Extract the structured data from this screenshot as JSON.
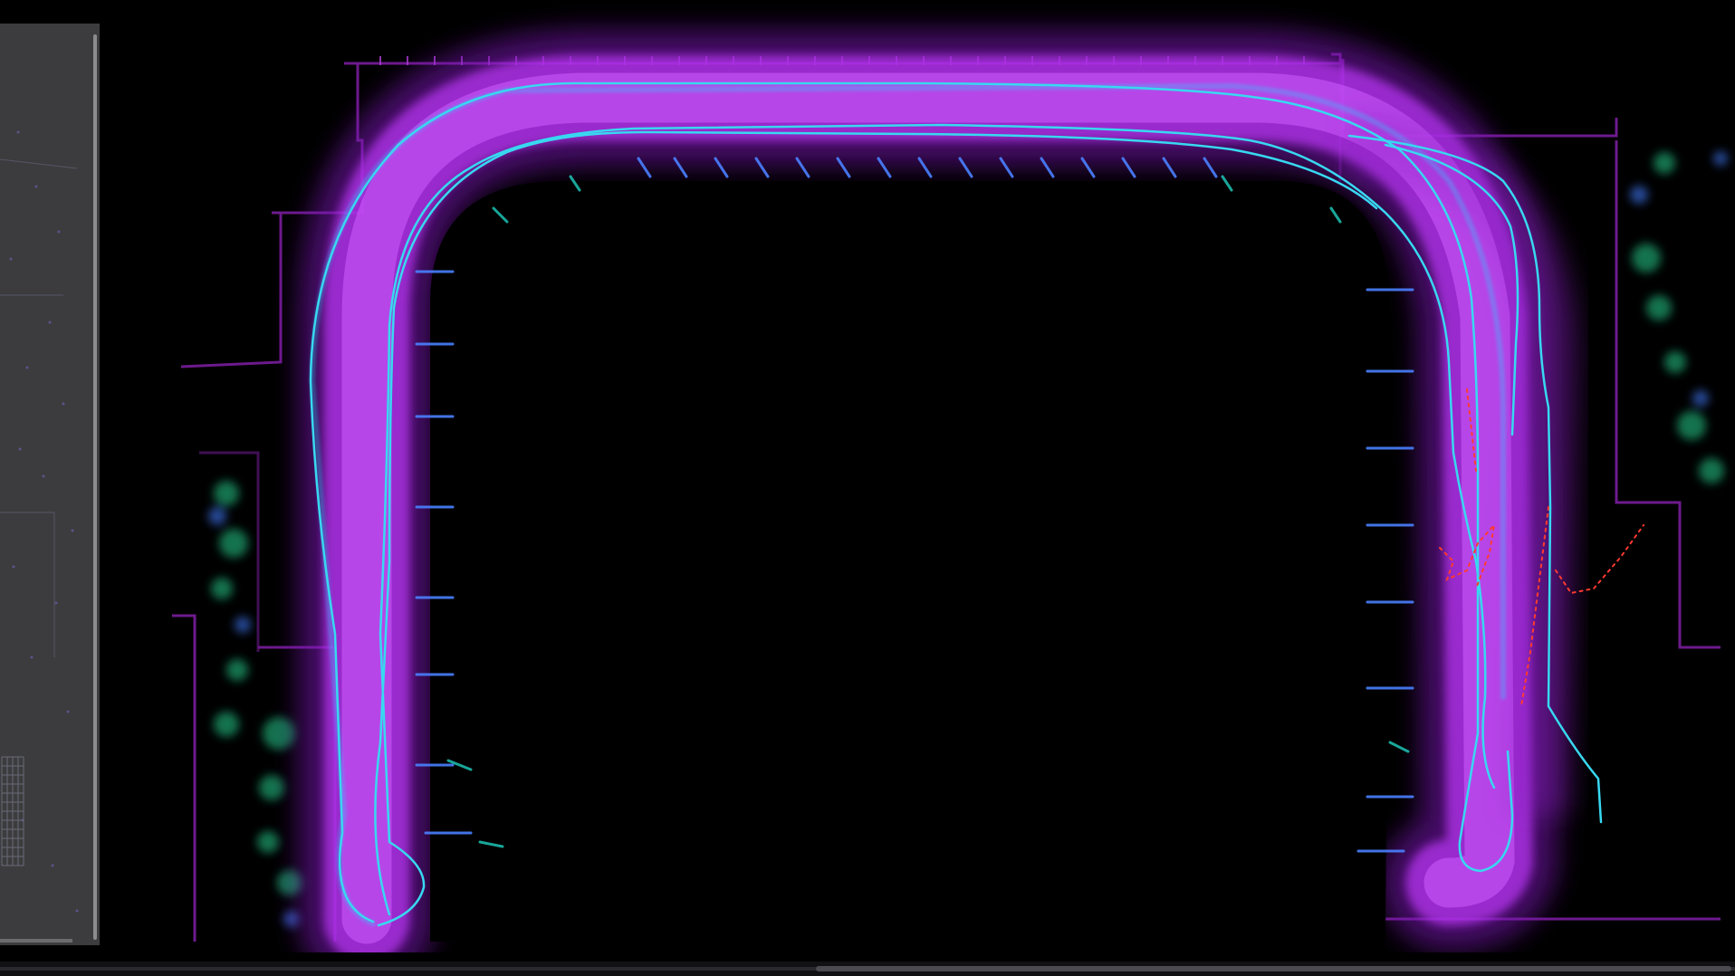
{
  "app": {
    "view": "point-cloud-viewer",
    "colors": {
      "background": "#000000",
      "panel": "#3c3c3e",
      "point_cloud": "#c03cff",
      "trajectory": "#33d6ee",
      "vegetation": "#22b07a",
      "vehicle_path": "#ff3a30"
    }
  },
  "side_panel": {
    "icon": "minimap-panel"
  },
  "viewport": {
    "icons": [
      "point-cloud-map",
      "trajectory-path"
    ]
  },
  "scrollbars": {
    "horizontal_position": 0.47
  }
}
